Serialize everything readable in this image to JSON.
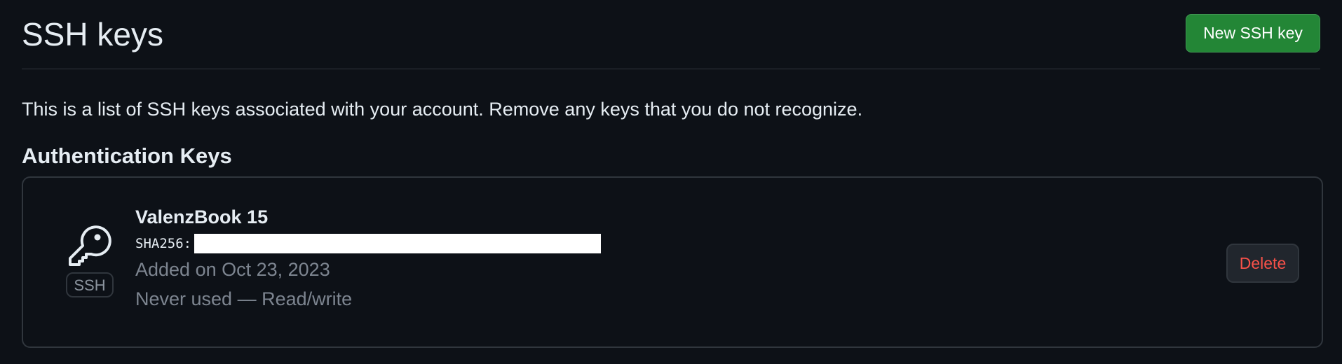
{
  "header": {
    "title": "SSH keys",
    "new_key_label": "New SSH key"
  },
  "description": "This is a list of SSH keys associated with your account. Remove any keys that you do not recognize.",
  "section": {
    "title": "Authentication Keys"
  },
  "keys": [
    {
      "icon": "key-icon",
      "type_badge": "SSH",
      "name": "ValenzBook 15",
      "fingerprint_label": "SHA256:",
      "added": "Added on Oct 23, 2023",
      "usage": "Never used — Read/write",
      "delete_label": "Delete"
    }
  ],
  "colors": {
    "background": "#0d1117",
    "primary_button": "#238636",
    "danger_text": "#f85149",
    "border": "#30363d",
    "muted_text": "#7d8590"
  }
}
